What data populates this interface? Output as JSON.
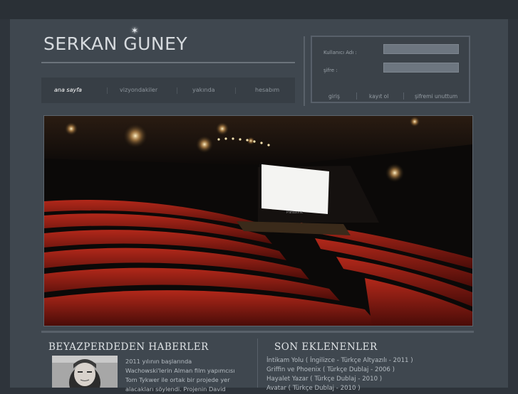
{
  "brand": {
    "name": "SERKAN GUNEY"
  },
  "nav": {
    "items": [
      {
        "label": "ana sayfa",
        "active": true
      },
      {
        "label": "vizyondakiler",
        "active": false
      },
      {
        "label": "yakında",
        "active": false
      },
      {
        "label": "hesabım",
        "active": false
      }
    ]
  },
  "login": {
    "username_label": "Kullanıcı Adı :",
    "password_label": "şifre :",
    "username_value": "",
    "password_value": "",
    "login_label": "giriş",
    "register_label": "kayıt ol",
    "forgot_label": "şifremi unuttum"
  },
  "hero": {
    "icon": "cinema-hall-photo",
    "screen_brand": "Panasonic"
  },
  "news": {
    "title": "BEYAZPERDEDEN HABERLER",
    "lines": [
      "2011 yılının başlarında",
      "Wachowski'lerin Alman film yapımcısı",
      "Tom Tykwer ile ortak bir projede yer",
      "alacakları söylendi. Projenin David"
    ],
    "photo_icon": "actor-portrait"
  },
  "latest": {
    "title": "SON EKLENENLER",
    "items": [
      "İntikam Yolu ( İngilizce - Türkçe Altyazılı - 2011 )",
      "Griffin ve Phoenix ( Türkçe Dublaj - 2006 )",
      "Hayalet Yazar ( Türkçe Dublaj - 2010 )",
      "Avatar ( Türkçe Dublaj - 2010 )"
    ]
  },
  "colors": {
    "background": "#2e343b",
    "panel": "#3f474f",
    "accent_seat_red": "#8a1b12",
    "screen_white": "#f4f4f2"
  }
}
